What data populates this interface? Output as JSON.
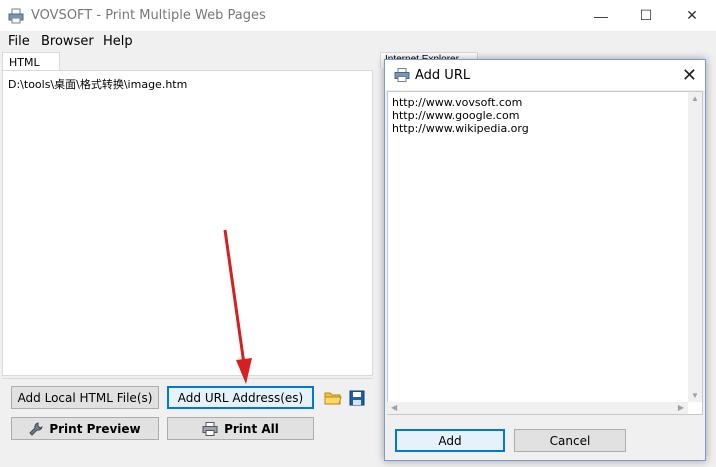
{
  "window": {
    "title": "VOVSOFT - Print Multiple Web Pages",
    "min_glyph": "—",
    "max_glyph": "☐",
    "close_glyph": "✕"
  },
  "menu": {
    "file": "File",
    "browser": "Browser",
    "help": "Help"
  },
  "tabs": {
    "html_list": "HTML List",
    "internet_explorer": "Internet Explorer"
  },
  "html_list": {
    "items": [
      "D:\\tools\\桌面\\格式转换\\image.htm"
    ]
  },
  "buttons": {
    "add_local": "Add Local HTML File(s)",
    "add_url": "Add URL Address(es)",
    "print_preview": "Print Preview",
    "print_all": "Print All"
  },
  "dialog": {
    "title": "Add URL",
    "close_glyph": "✕",
    "urls": [
      "http://www.vovsoft.com",
      "http://www.google.com",
      "http://www.wikipedia.org"
    ],
    "add_label": "Add",
    "cancel_label": "Cancel"
  },
  "colors": {
    "accent": "#0078d7",
    "annotation_arrow": "#d42020"
  },
  "icons": {
    "app": "printer-icon",
    "open_folder": "folder-open-icon",
    "save": "save-floppy-icon",
    "print_preview": "wrench-icon",
    "print_all": "printer-icon"
  }
}
